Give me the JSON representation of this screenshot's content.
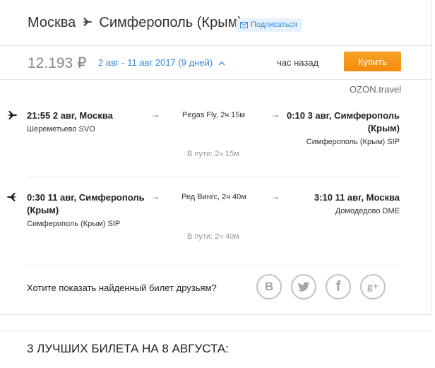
{
  "header": {
    "origin": "Москва",
    "destination": "Симферополь (Крым)",
    "subscribe_label": "Подписаться"
  },
  "offer": {
    "price": "12.193 ₽",
    "dates": "2 авг - 11 авг 2017 (9 дней)",
    "updated": "час назад",
    "buy_label": "Купить",
    "provider": "OZON.travel"
  },
  "segments": [
    {
      "dep_time": "21:55 2 авг, Москва",
      "dep_airport": "Шереметьево SVO",
      "carrier": "Pegas Fly, 2ч 15м",
      "arr_time_line1": "0:10 3 авг, Симферополь",
      "arr_time_line2": "(Крым)",
      "arr_airport": "Симферополь (Крым) SIP",
      "duration": "В пути: 2ч 15м"
    },
    {
      "dep_time_line1": "0:30 11 авг, Симферополь",
      "dep_time_line2": "(Крым)",
      "dep_airport": "Симферополь (Крым) SIP",
      "carrier": "Ред Вингс, 2ч 40м",
      "arr_time": "3:10 11 авг, Москва",
      "arr_airport": "Домодедово DME",
      "duration": "В пути: 2ч 40м"
    }
  ],
  "share": {
    "question": "Хотите показать найденный билет друзьям?",
    "icons": [
      "vk-icon",
      "twitter-icon",
      "facebook-icon",
      "google-plus-icon"
    ],
    "vk": "В",
    "facebook": "f",
    "gplus": "g+"
  },
  "bottom": {
    "title": "3 ЛУЧШИХ БИЛЕТА НА 8 АВГУСТА:"
  },
  "colors": {
    "accent_blue": "#3a8ad6",
    "buy_orange": "#f28b0c",
    "social_gray": "#c2c2c2"
  }
}
